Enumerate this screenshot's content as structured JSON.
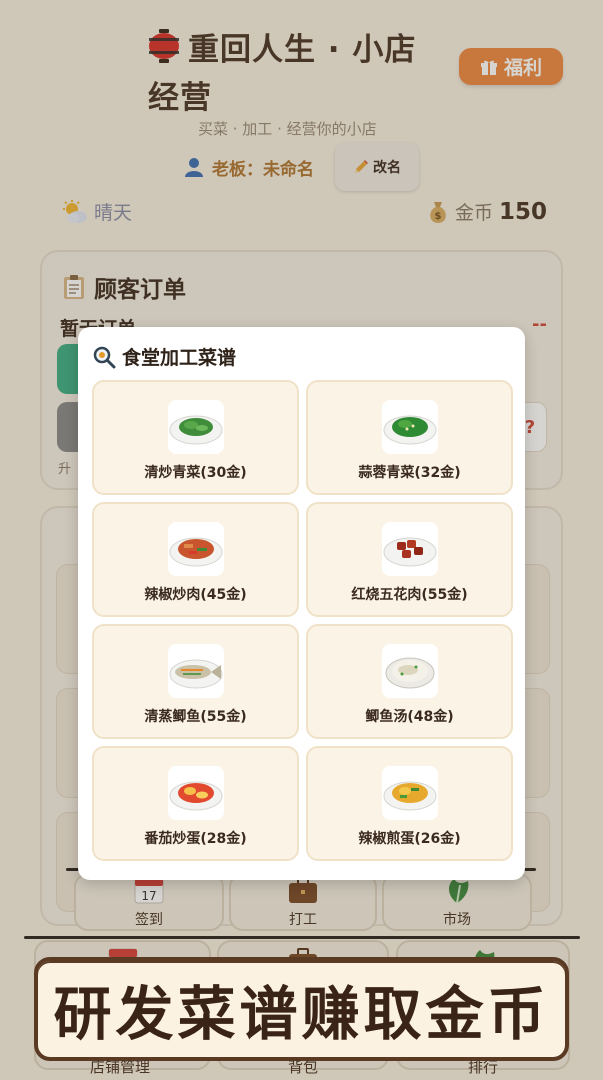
{
  "header": {
    "title": "重回人生 · 小店",
    "title_cont": "经营",
    "welfare_label": "福利",
    "subtitle": "买菜 · 加工 · 经营你的小店",
    "boss_label": "老板：",
    "boss_name": "未命名",
    "rename_label": "改名",
    "weather": "晴天",
    "coin_label": "金币",
    "coin_value": "150"
  },
  "orders": {
    "title": "顾客订单",
    "empty_text": "暂无订单",
    "dash": "--",
    "upgrade_hint": "升",
    "qmark": "?"
  },
  "modal": {
    "title": "食堂加工菜谱",
    "recipes": [
      {
        "name": "清炒青菜(30金)",
        "icon": "stir-fried-greens"
      },
      {
        "name": "蒜蓉青菜(32金)",
        "icon": "garlic-greens"
      },
      {
        "name": "辣椒炒肉(45金)",
        "icon": "chili-pork"
      },
      {
        "name": "红烧五花肉(55金)",
        "icon": "braised-pork"
      },
      {
        "name": "清蒸鲫鱼(55金)",
        "icon": "steamed-fish"
      },
      {
        "name": "鲫鱼汤(48金)",
        "icon": "fish-soup"
      },
      {
        "name": "番茄炒蛋(28金)",
        "icon": "tomato-egg"
      },
      {
        "name": "辣椒煎蛋(26金)",
        "icon": "chili-egg"
      }
    ]
  },
  "nav_top": [
    {
      "label": "签到",
      "icon": "calendar-icon"
    },
    {
      "label": "打工",
      "icon": "briefcase-icon"
    },
    {
      "label": "市场",
      "icon": "vegetable-icon"
    }
  ],
  "nav_bottom": [
    {
      "label": "店铺管理",
      "icon": "calendar-icon"
    },
    {
      "label": "背包",
      "icon": "briefcase-icon"
    },
    {
      "label": "排行",
      "icon": "vegetable-icon"
    }
  ],
  "banner": {
    "text": "研发菜谱赚取金币"
  },
  "colors": {
    "accent": "#ee8a42",
    "background": "#f6efe1",
    "card": "#fbf3e5",
    "text": "#4a3526"
  }
}
